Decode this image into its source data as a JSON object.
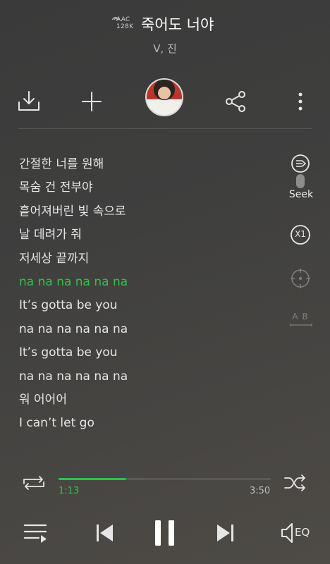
{
  "header": {
    "quality_line1": "AAC",
    "quality_line2": "128K",
    "title": "죽어도 너야",
    "artist": "V, 진"
  },
  "actions": {
    "download_icon": "download-icon",
    "add_icon": "plus-icon",
    "share_icon": "share-icon",
    "more_icon": "more-vertical-icon"
  },
  "lyrics": [
    {
      "text": "간절한 너를 원해",
      "active": false
    },
    {
      "text": "목숨 건 전부야",
      "active": false
    },
    {
      "text": "흩어져버린 빛 속으로",
      "active": false
    },
    {
      "text": "날 데려가 줘",
      "active": false
    },
    {
      "text": "저세상 끝까지",
      "active": false
    },
    {
      "text": "na na na na na na",
      "active": true
    },
    {
      "text": "It’s gotta be you",
      "active": false
    },
    {
      "text": "na na na na na na",
      "active": false
    },
    {
      "text": "It’s gotta be you",
      "active": false
    },
    {
      "text": "na na na na na na",
      "active": false
    },
    {
      "text": "워 어어어",
      "active": false
    },
    {
      "text": "I can’t let go",
      "active": false
    }
  ],
  "side_controls": {
    "seek_label": "Seek",
    "speed_label": "X1",
    "ab_label": "A B"
  },
  "progress": {
    "current": "1:13",
    "total": "3:50",
    "fraction": 0.32
  },
  "controls": {
    "eq_label": "EQ"
  },
  "colors": {
    "accent": "#2fc24a",
    "text": "#e6e6e6",
    "muted": "#8a8986"
  }
}
